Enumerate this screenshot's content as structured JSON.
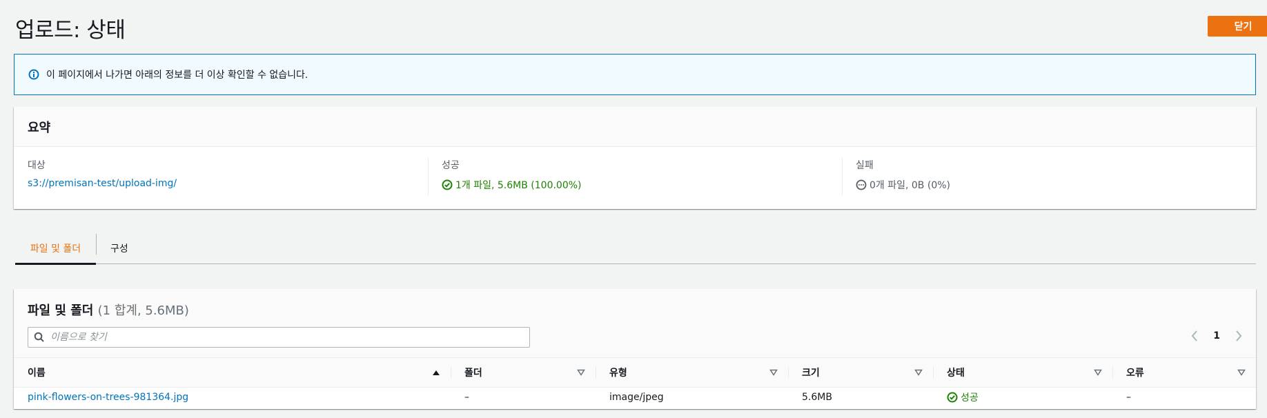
{
  "header": {
    "title": "업로드: 상태",
    "close_label": "닫기"
  },
  "alert": {
    "text": "이 페이지에서 나가면 아래의 정보를 더 이상 확인할 수 없습니다."
  },
  "summary": {
    "title": "요약",
    "destination": {
      "label": "대상",
      "value": "s3://premisan-test/upload-img/"
    },
    "succeeded": {
      "label": "성공",
      "value": "1개 파일, 5.6MB (100.00%)"
    },
    "failed": {
      "label": "실패",
      "value": "0개 파일, 0B (0%)"
    }
  },
  "tabs": [
    {
      "label": "파일 및 폴더",
      "active": true
    },
    {
      "label": "구성",
      "active": false
    }
  ],
  "files": {
    "title": "파일 및 폴더",
    "count": "(1 합계, 5.6MB)",
    "search_placeholder": "이름으로 찾기",
    "page": "1",
    "columns": [
      "이름",
      "폴더",
      "유형",
      "크기",
      "상태",
      "오류"
    ],
    "rows": [
      {
        "name": "pink-flowers-on-trees-981364.jpg",
        "folder": "–",
        "type": "image/jpeg",
        "size": "5.6MB",
        "status": "성공",
        "error": "–"
      }
    ]
  },
  "colors": {
    "accent": "#ec7211",
    "link": "#0073bb",
    "success": "#1d8102",
    "info_border": "#0073bb"
  }
}
